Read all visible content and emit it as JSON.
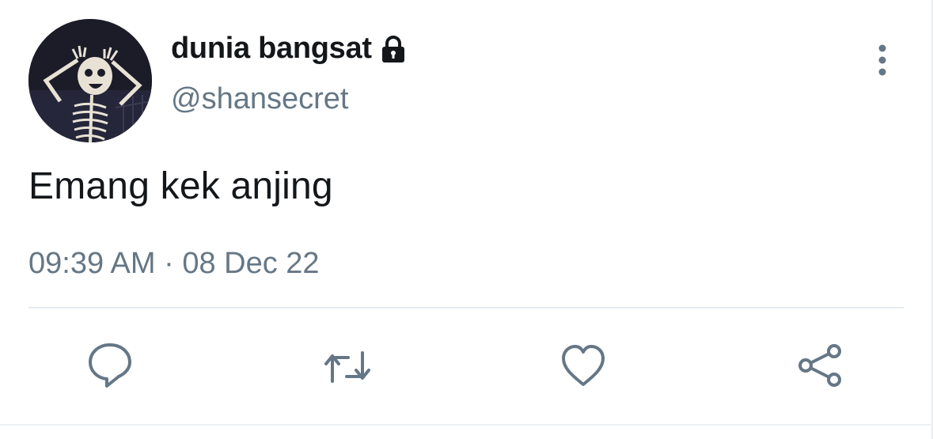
{
  "tweet": {
    "display_name": "dunia bangsat",
    "handle": "@shansecret",
    "text": "Emang kek anjing",
    "timestamp": "09:39 AM · 08 Dec 22",
    "protected": true,
    "avatar_description": "skeleton-screaming-avatar"
  },
  "icons": {
    "lock": "lock-icon",
    "more": "more-vertical-icon",
    "reply": "reply-bubble-icon",
    "retweet": "retweet-icon",
    "like": "heart-icon",
    "share": "share-icon"
  },
  "colors": {
    "primary_text": "#14171a",
    "secondary_text": "#657786",
    "divider": "#e6ecf0",
    "background": "#ffffff"
  }
}
